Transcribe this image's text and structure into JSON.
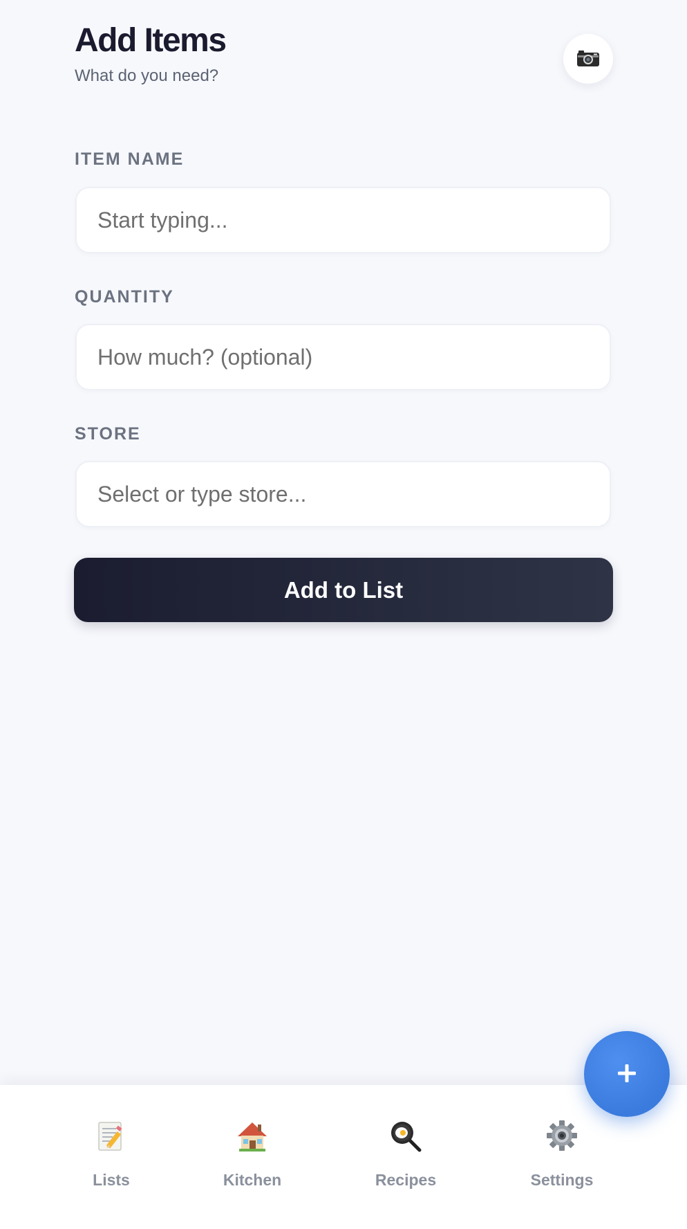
{
  "header": {
    "title": "Add Items",
    "subtitle": "What do you need?",
    "camera_icon": "camera-icon"
  },
  "form": {
    "item_name": {
      "label": "ITEM NAME",
      "value": "",
      "placeholder": "Start typing..."
    },
    "quantity": {
      "label": "QUANTITY",
      "value": "",
      "placeholder": "How much? (optional)"
    },
    "store": {
      "label": "STORE",
      "value": "",
      "placeholder": "Select or type store..."
    },
    "submit_label": "Add to List"
  },
  "fab": {
    "icon": "plus-icon"
  },
  "nav": {
    "items": [
      {
        "label": "Lists",
        "icon": "memo-icon"
      },
      {
        "label": "Kitchen",
        "icon": "house-icon"
      },
      {
        "label": "Recipes",
        "icon": "frying-pan-icon"
      },
      {
        "label": "Settings",
        "icon": "gear-icon"
      }
    ]
  },
  "colors": {
    "background": "#f7f8fc",
    "title": "#1a1b2e",
    "button": "#1b1c30",
    "accent": "#3a7bdd",
    "label": "#6b7280"
  }
}
